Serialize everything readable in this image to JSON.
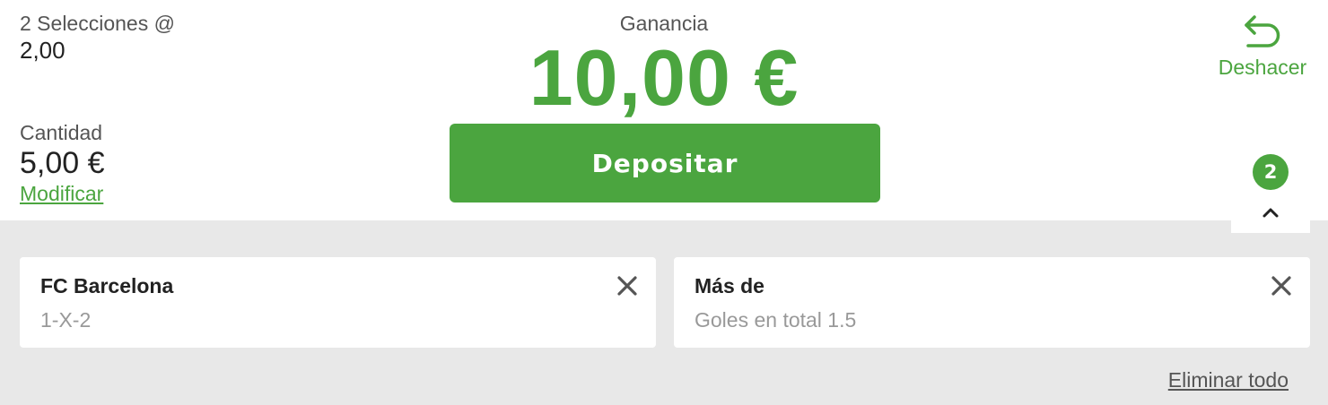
{
  "summary": {
    "selections_label": "2 Selecciones @",
    "odds": "2,00",
    "stake_label": "Cantidad",
    "stake_value": "5,00 €",
    "modify_label": "Modificar"
  },
  "winnings": {
    "label": "Ganancia",
    "value": "10,00 €"
  },
  "deposit_button": {
    "label": "Depositar"
  },
  "undo": {
    "label": "Deshacer",
    "icon": "undo-arrow-icon"
  },
  "collapse_tab": {
    "badge": "2",
    "icon": "chevron-up-icon"
  },
  "selections": [
    {
      "title": "FC Barcelona",
      "market": "1-X-2",
      "icon": "close-icon"
    },
    {
      "title": "Más de",
      "market": "Goles en total 1.5",
      "icon": "close-icon"
    }
  ],
  "remove_all_label": "Eliminar todo",
  "colors": {
    "accent": "#4ba53f",
    "panel_background": "#e8e8e8",
    "card_background": "#ffffff"
  }
}
